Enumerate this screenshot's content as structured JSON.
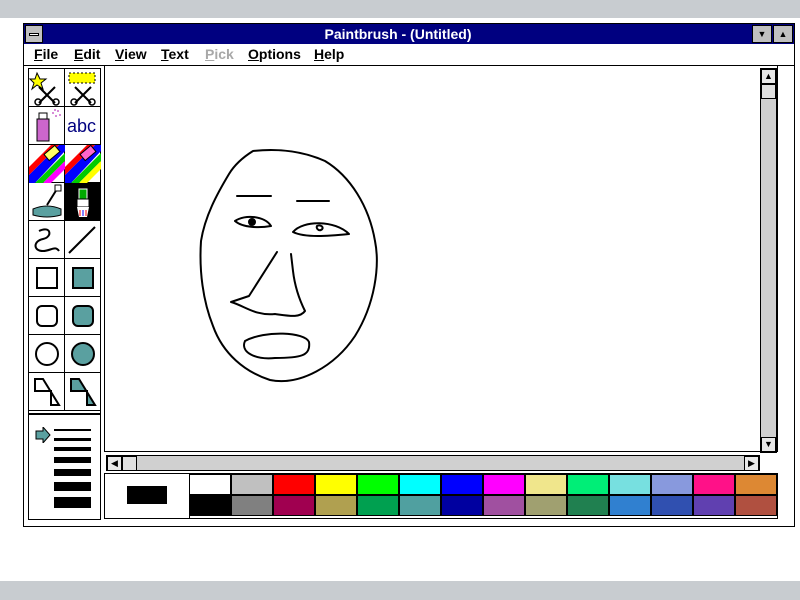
{
  "window": {
    "title": "Paintbrush - (Untitled)"
  },
  "menu": {
    "items": [
      {
        "label": "File",
        "name": "menu-file",
        "enabled": true
      },
      {
        "label": "Edit",
        "name": "menu-edit",
        "enabled": true
      },
      {
        "label": "View",
        "name": "menu-view",
        "enabled": true
      },
      {
        "label": "Text",
        "name": "menu-text",
        "enabled": true
      },
      {
        "label": "Pick",
        "name": "menu-pick",
        "enabled": false
      },
      {
        "label": "Options",
        "name": "menu-options",
        "enabled": true
      },
      {
        "label": "Help",
        "name": "menu-help",
        "enabled": true
      }
    ]
  },
  "toolbox": {
    "tools": [
      {
        "icon": "scissors-free-select-icon",
        "name": "tool-scissors"
      },
      {
        "icon": "pick-rectangle-select-icon",
        "name": "tool-pick"
      },
      {
        "icon": "airbrush-icon",
        "name": "tool-airbrush"
      },
      {
        "icon": "text-tool-icon",
        "name": "tool-text",
        "label": "abc"
      },
      {
        "icon": "color-eraser-icon",
        "name": "tool-color-eraser"
      },
      {
        "icon": "eraser-icon",
        "name": "tool-eraser"
      },
      {
        "icon": "paint-roller-icon",
        "name": "tool-paint-roller"
      },
      {
        "icon": "brush-icon",
        "name": "tool-brush",
        "selected": true
      },
      {
        "icon": "curve-icon",
        "name": "tool-curve"
      },
      {
        "icon": "line-icon",
        "name": "tool-line"
      },
      {
        "icon": "box-icon",
        "name": "tool-box"
      },
      {
        "icon": "filled-box-icon",
        "name": "tool-filled-box"
      },
      {
        "icon": "rounded-box-icon",
        "name": "tool-rounded-box"
      },
      {
        "icon": "filled-rounded-box-icon",
        "name": "tool-filled-rounded-box"
      },
      {
        "icon": "circle-ellipse-icon",
        "name": "tool-circle"
      },
      {
        "icon": "filled-circle-ellipse-icon",
        "name": "tool-filled-circle"
      },
      {
        "icon": "polygon-icon",
        "name": "tool-polygon"
      },
      {
        "icon": "filled-polygon-icon",
        "name": "tool-filled-polygon"
      }
    ]
  },
  "linesize": {
    "selected_index": 0,
    "count": 8,
    "pointer_icon": "right-arrow-icon"
  },
  "palette": {
    "foreground": "#000000",
    "background": "#ffffff",
    "colors_top": [
      "#ffffff",
      "#c0c0c0",
      "#ff0000",
      "#ffff00",
      "#00ff00",
      "#00ffff",
      "#0000ff",
      "#ff00ff",
      "#f0e68c",
      "#00ee77",
      "#77e0e0",
      "#8899dd",
      "#ff1188",
      "#dd8833"
    ],
    "colors_bottom": [
      "#000000",
      "#808080",
      "#a00050",
      "#b0a050",
      "#00a050",
      "#50a0a0",
      "#0000a0",
      "#a050a0",
      "#a0a070",
      "#208050",
      "#3080d0",
      "#3050b0",
      "#6040b0",
      "#b05040"
    ]
  },
  "scroll": {
    "up_icon": "arrow-up-icon",
    "down_icon": "arrow-down-icon",
    "left_icon": "arrow-left-icon",
    "right_icon": "arrow-right-icon"
  },
  "canvas": {
    "drawing": "face-sketch"
  }
}
